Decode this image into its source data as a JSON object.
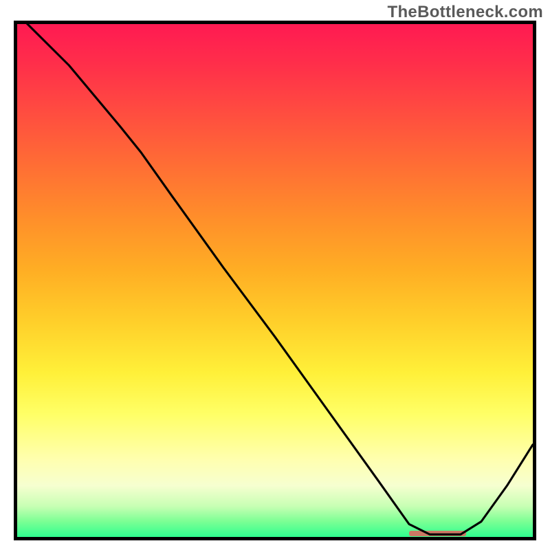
{
  "watermark": "TheBottleneck.com",
  "colors": {
    "border": "#000000",
    "line": "#000000",
    "marker": "#d96a5f",
    "gradient_top": "#ff1a52",
    "gradient_bottom": "#2fff90"
  },
  "chart_data": {
    "type": "line",
    "title": "",
    "xlabel": "",
    "ylabel": "",
    "xlim": [
      0,
      100
    ],
    "ylim": [
      0,
      100
    ],
    "grid": false,
    "legend": false,
    "x": [
      0,
      3,
      10,
      20,
      24,
      30,
      40,
      50,
      60,
      70,
      76,
      80,
      86,
      90,
      95,
      100
    ],
    "values": [
      102,
      99,
      92,
      80,
      75,
      66.5,
      52.5,
      39,
      25,
      11,
      2.5,
      0.5,
      0.5,
      3,
      10,
      18
    ],
    "marker_span_x": [
      76,
      87
    ],
    "marker_y": 0.5,
    "notes": "Values approximate a curve that starts at top-left, descends steeply, bottoms out near x≈76–86, then rises. Background is a vertical heatmap gradient from red (top) to green (bottom)."
  }
}
